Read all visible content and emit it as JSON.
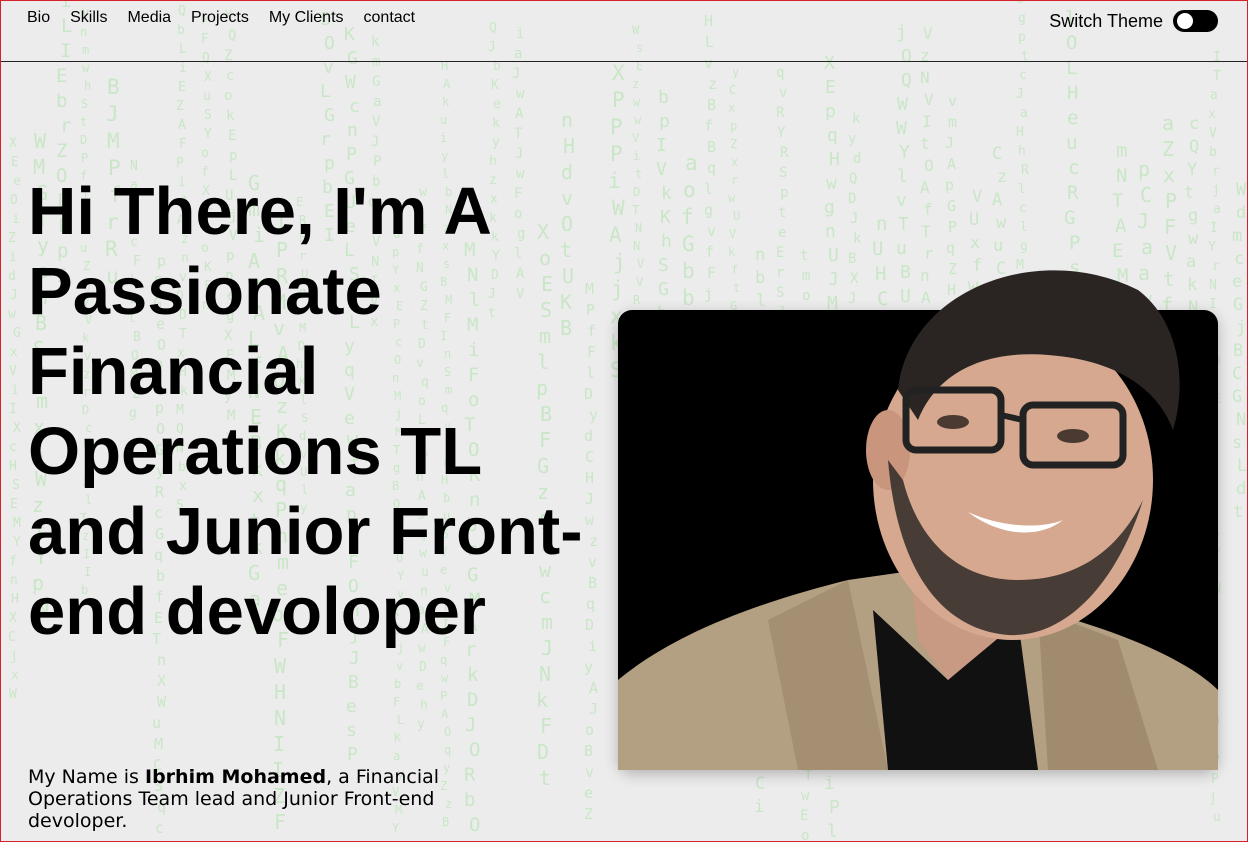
{
  "nav": {
    "links": [
      "Bio",
      "Skills",
      "Media",
      "Projects",
      "My Clients",
      "contact"
    ]
  },
  "theme": {
    "label": "Switch Theme",
    "state": "off"
  },
  "hero": {
    "title": "Hi There, I'm A Passionate Financial Operations TL and Junior Front-end devoloper",
    "intro_before": "My Name is ",
    "intro_name": "Ibrhim Mohamed",
    "intro_after": ", a Financial Operations Team lead and Junior Front-end devoloper."
  },
  "colors": {
    "background": "#ececec",
    "matrix_glyph": "#9fe09a",
    "frame": "#d8202a",
    "toggle": "#000000",
    "photo_bg": "#000000"
  }
}
